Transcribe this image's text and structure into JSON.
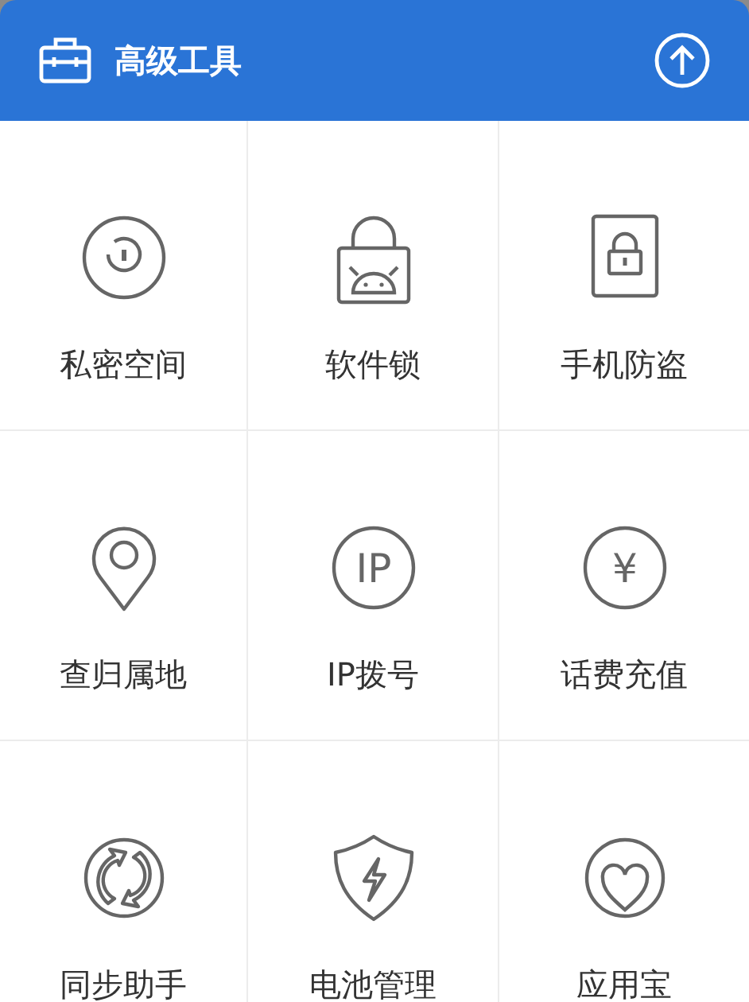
{
  "header": {
    "title": "高级工具"
  },
  "rows": [
    {
      "tools": [
        {
          "label": "私密空间"
        },
        {
          "label": "软件锁"
        },
        {
          "label": "手机防盗"
        }
      ]
    },
    {
      "tools": [
        {
          "label": "查归属地"
        },
        {
          "label": "IP拨号",
          "icon_text": "IP"
        },
        {
          "label": "话费充值",
          "icon_text": "¥"
        }
      ]
    },
    {
      "tools": [
        {
          "label": "同步助手"
        },
        {
          "label": "电池管理"
        },
        {
          "label": "应用宝"
        }
      ]
    }
  ]
}
